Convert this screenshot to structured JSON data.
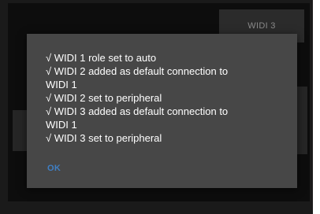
{
  "background": {
    "button_label": "WIDI 3"
  },
  "dialog": {
    "lines": [
      "√ WIDI 1 role set to auto",
      "√ WIDI 2 added as default connection to",
      "WIDI 1",
      "√ WIDI 2 set to peripheral",
      "√ WIDI 3 added as default connection to",
      "WIDI 1",
      "√ WIDI 3 set to peripheral"
    ],
    "ok_label": "OK"
  },
  "colors": {
    "dialog_background": "#474747",
    "accent": "#3f7fc4",
    "screen_background": "#1a1a1a"
  }
}
